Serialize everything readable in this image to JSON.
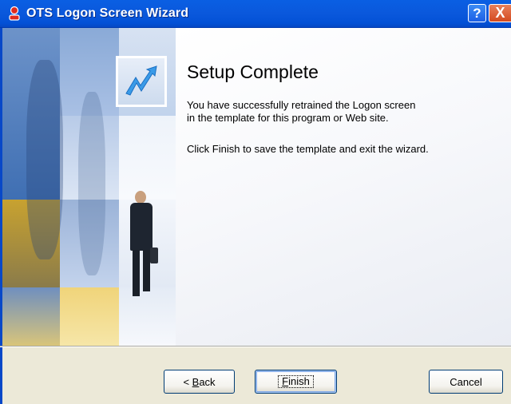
{
  "window": {
    "title": "OTS Logon Screen Wizard",
    "help_label": "?",
    "close_label": "X"
  },
  "content": {
    "heading": "Setup Complete",
    "line1": "You have successfully retrained the Logon screen",
    "line2": "in the template for this program or Web site.",
    "line3": "Click Finish to save the template and exit the wizard."
  },
  "buttons": {
    "back_prefix": "< ",
    "back_key": "B",
    "back_rest": "ack",
    "finish_key": "F",
    "finish_rest": "inish",
    "cancel": "Cancel"
  },
  "colors": {
    "titlebar": "#0a5fe3",
    "dialog_face": "#ece9d8",
    "logo_arrow": "#3a9be8"
  },
  "icons": {
    "app": "red-user-key-icon",
    "wizard_logo": "blue-arrow-logo-icon"
  }
}
